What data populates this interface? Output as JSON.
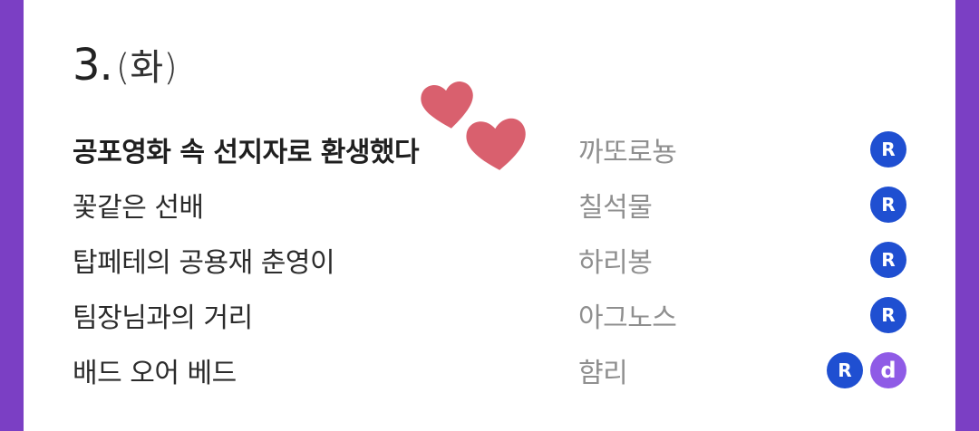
{
  "section": {
    "number": "3.",
    "day": "(화)"
  },
  "items": [
    {
      "title": "공포영화 속 선지자로 환생했다",
      "author": "까또로뇽",
      "badges": [
        "R"
      ],
      "bold": true
    },
    {
      "title": "꽃같은 선배",
      "author": "칠석물",
      "badges": [
        "R"
      ]
    },
    {
      "title": "탑페테의 공용재 춘영이",
      "author": "하리봉",
      "badges": [
        "R"
      ]
    },
    {
      "title": "팀장님과의 거리",
      "author": "아그노스",
      "badges": [
        "R"
      ]
    },
    {
      "title": "배드 오어 베드",
      "author": "햠리",
      "badges": [
        "R",
        "d"
      ]
    }
  ],
  "colors": {
    "background": "#7b3fc4",
    "badge_r": "#1f4fd1",
    "badge_d": "#8f5be6",
    "heart": "#d9606e"
  }
}
